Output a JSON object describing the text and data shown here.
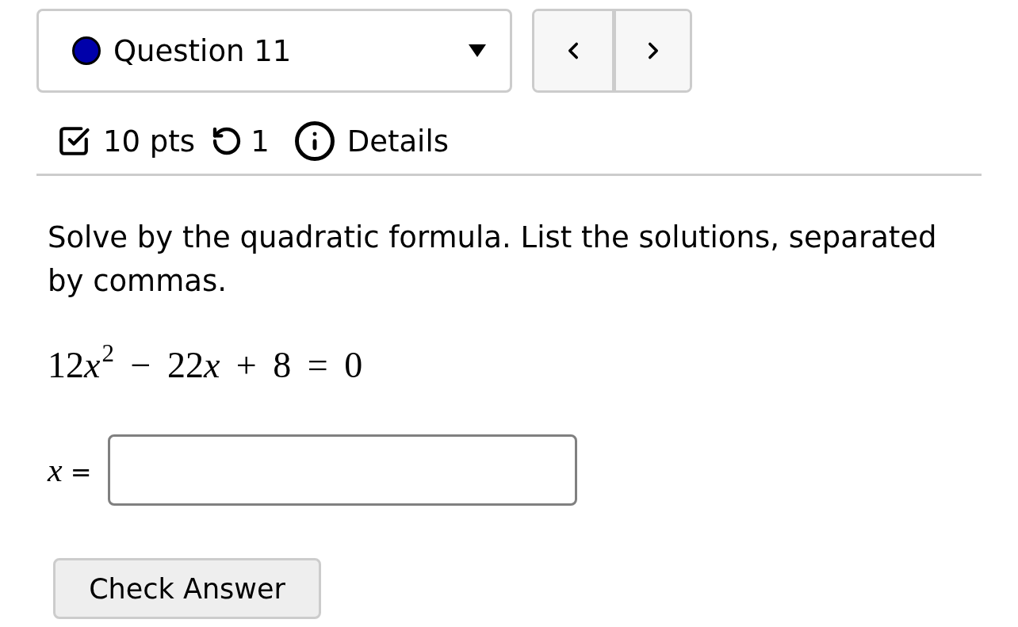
{
  "question_selector": {
    "label": "Question 11",
    "color": "#0000aa"
  },
  "meta": {
    "points": "10 pts",
    "attempts": "1",
    "details": "Details"
  },
  "question": {
    "prompt": "Solve by the quadratic formula. List the solutions, separated by commas.",
    "equation": [
      {
        "kind": "number",
        "text": "12"
      },
      {
        "kind": "variable",
        "text": "x"
      },
      {
        "kind": "exponent",
        "text": "2"
      },
      {
        "kind": "operator",
        "text": "−"
      },
      {
        "kind": "number",
        "text": "22"
      },
      {
        "kind": "variable",
        "text": "x"
      },
      {
        "kind": "operator",
        "text": "+"
      },
      {
        "kind": "number",
        "text": "8"
      },
      {
        "kind": "operator",
        "text": "="
      },
      {
        "kind": "number",
        "text": "0"
      }
    ],
    "answer": {
      "label": "*x* ="
    }
  },
  "check_button": "Check Answer"
}
